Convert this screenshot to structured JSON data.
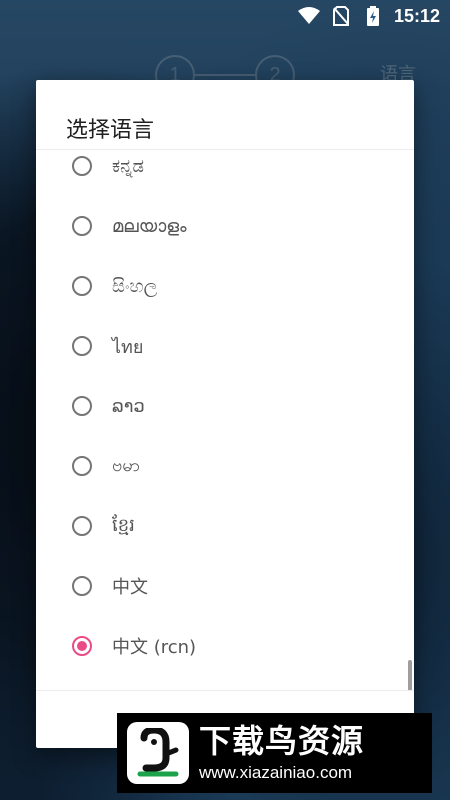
{
  "status_bar": {
    "time": "15:12",
    "icons": [
      "wifi-icon",
      "no-sim-icon",
      "battery-charging-icon"
    ]
  },
  "background": {
    "steps": [
      "1",
      "2"
    ],
    "language_label": "语言"
  },
  "dialog": {
    "title": "选择语言",
    "options": [
      {
        "label": "ಕನ್ನಡ",
        "selected": false
      },
      {
        "label": "മലയാളം",
        "selected": false
      },
      {
        "label": "සිංහල",
        "selected": false
      },
      {
        "label": "ไทย",
        "selected": false
      },
      {
        "label": "ລາວ",
        "selected": false
      },
      {
        "label": "ဗမာ",
        "selected": false
      },
      {
        "label": "ខ្មែរ",
        "selected": false
      },
      {
        "label": "中文",
        "selected": false
      },
      {
        "label": "中文 (rcn)",
        "selected": true
      }
    ]
  },
  "watermark": {
    "name": "下载鸟资源",
    "url": "www.xiazainiao.com"
  },
  "colors": {
    "accent": "#e94b86",
    "radio_unchecked": "#757575",
    "label_text": "#555555"
  }
}
